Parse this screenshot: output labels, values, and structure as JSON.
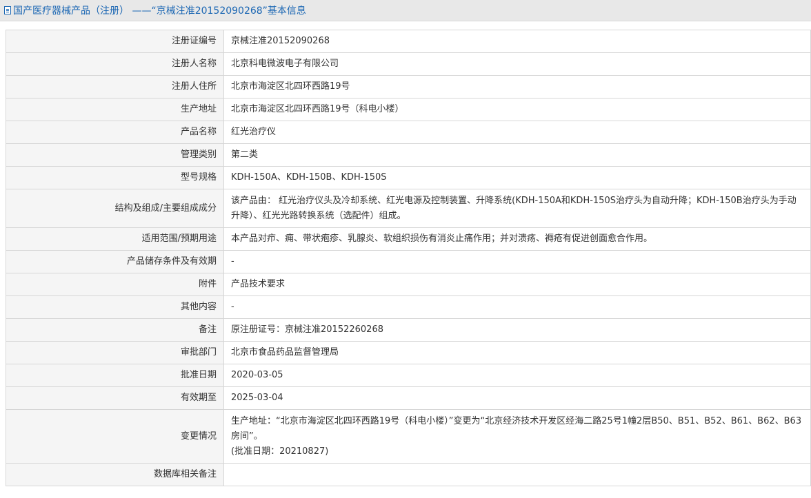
{
  "header": {
    "title": "国产医疗器械产品（注册） ——“京械注准20152090268”基本信息"
  },
  "rows": [
    {
      "label": "注册证编号",
      "value": "京械注准20152090268"
    },
    {
      "label": "注册人名称",
      "value": "北京科电微波电子有限公司"
    },
    {
      "label": "注册人住所",
      "value": "北京市海淀区北四环西路19号"
    },
    {
      "label": "生产地址",
      "value": "北京市海淀区北四环西路19号（科电小楼）"
    },
    {
      "label": "产品名称",
      "value": "红光治疗仪"
    },
    {
      "label": "管理类别",
      "value": "第二类"
    },
    {
      "label": "型号规格",
      "value": "KDH-150A、KDH-150B、KDH-150S"
    },
    {
      "label": "结构及组成/主要组成成分",
      "value": "该产品由： 红光治疗仪头及冷却系统、红光电源及控制装置、升降系统(KDH-150A和KDH-150S治疗头为自动升降；KDH-150B治疗头为手动升降）、红光光路转换系统（选配件）组成。"
    },
    {
      "label": "适用范围/预期用途",
      "value": "本产品对疖、痈、带状疱疹、乳腺炎、软组织损伤有消炎止痛作用；并对溃疡、褥疮有促进创面愈合作用。"
    },
    {
      "label": "产品储存条件及有效期",
      "value": "-"
    },
    {
      "label": "附件",
      "value": "产品技术要求"
    },
    {
      "label": "其他内容",
      "value": "-"
    },
    {
      "label": "备注",
      "value": "原注册证号：京械注准20152260268"
    },
    {
      "label": "审批部门",
      "value": "北京市食品药品监督管理局"
    },
    {
      "label": "批准日期",
      "value": "2020-03-05"
    },
    {
      "label": "有效期至",
      "value": "2025-03-04"
    },
    {
      "label": "变更情况",
      "value_line1": "生产地址：“北京市海淀区北四环西路19号（科电小楼）”变更为“北京经济技术开发区经海二路25号1幢2层B50、B51、B52、B61、B62、B63房间”。",
      "value_line2": "(批准日期：20210827)"
    },
    {
      "label": "数据库相关备注",
      "value": ""
    }
  ]
}
